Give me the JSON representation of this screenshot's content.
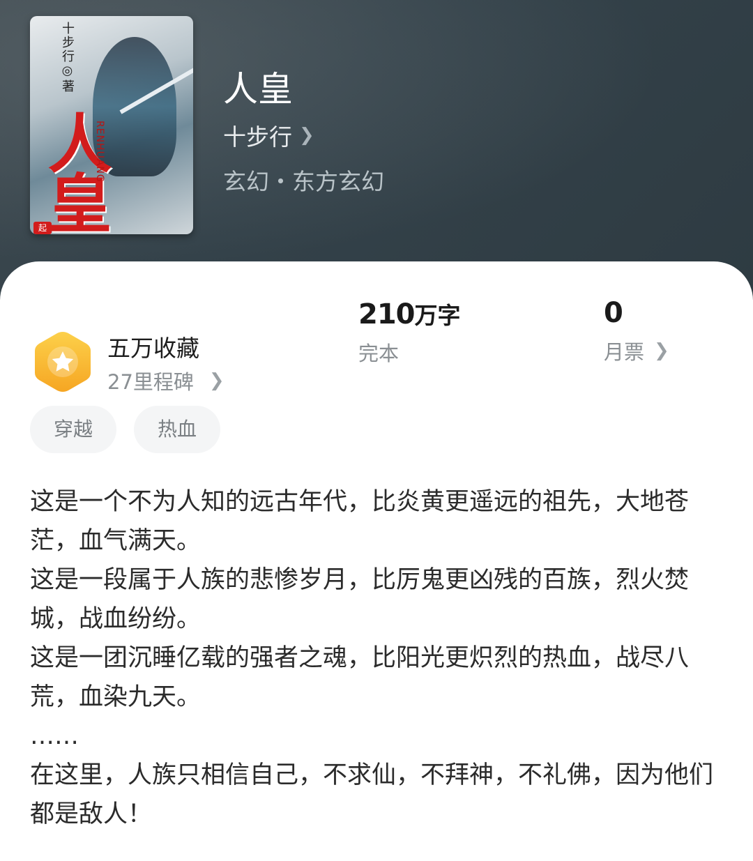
{
  "book": {
    "cover_title": "人皇",
    "cover_author": "十步行◎著",
    "cover_pinyin": "RENHUANG",
    "cover_badge": "起",
    "title": "人皇",
    "author": "十步行",
    "genre": "玄幻・东方玄幻"
  },
  "milestone": {
    "title": "五万收藏",
    "subtitle": "27里程碑"
  },
  "stats": {
    "words_number": "210",
    "words_unit": "万字",
    "words_label": "完本",
    "votes_number": "0",
    "votes_label": "月票"
  },
  "tags": [
    "穿越",
    "热血"
  ],
  "synopsis": [
    "这是一个不为人知的远古年代，比炎黄更遥远的祖先，大地苍茫，血气满天。",
    "这是一段属于人族的悲惨岁月，比厉鬼更凶残的百族，烈火焚城，战血纷纷。",
    "这是一团沉睡亿载的强者之魂，比阳光更炽烈的热血，战尽八荒，血染九天。",
    "……",
    "在这里，人族只相信自己，不求仙，不拜神，不礼佛，因为他们都是敌人！"
  ],
  "icons": {
    "chevron": "chevron-right-icon",
    "milestone": "star-hexagon-icon"
  },
  "colors": {
    "header_bg": "#34424a",
    "badge_orange": "#f6a623",
    "badge_yellow": "#fcd04a"
  }
}
